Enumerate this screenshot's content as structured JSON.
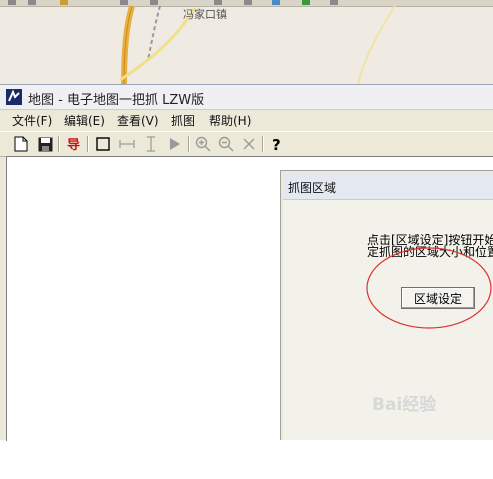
{
  "map": {
    "place_label": "冯家口镇"
  },
  "window": {
    "title": "地图 - 电子地图一把抓 LZW版"
  },
  "menu": {
    "items": [
      "文件(F)",
      "编辑(E)",
      "查看(V)",
      "抓图",
      "帮助(H)"
    ]
  },
  "toolbar": {
    "icons": [
      "new-document-icon",
      "save-icon",
      "export-icon",
      "rectangle-icon",
      "horizontal-measure-icon",
      "vertical-measure-icon",
      "play-icon",
      "zoom-in-icon",
      "zoom-out-icon",
      "close-icon",
      "help-icon"
    ]
  },
  "panel": {
    "title": "抓图区域",
    "instruction_line1": "点击[区域设定]按钮开始",
    "instruction_line2": "定抓图的区域大小和位置",
    "button_label": "区域设定",
    "highlight_color": "#e03030"
  },
  "watermark": {
    "text": "Bai经验"
  }
}
